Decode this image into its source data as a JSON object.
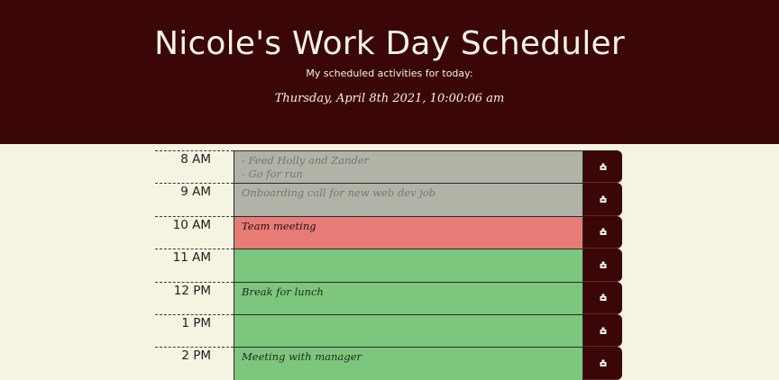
{
  "header": {
    "title": "Nicole's Work Day Scheduler",
    "subtitle": "My scheduled activities for today:",
    "datetime": "Thursday, April 8th 2021, 10:00:06 am"
  },
  "colors": {
    "header_bg": "#3a0608",
    "page_bg": "#f5f3e1",
    "past": "#b1b3a7",
    "present": "#e77b76",
    "future": "#7dc67d"
  },
  "save_icon": "save-icon",
  "hours": [
    {
      "hour": "8 AM",
      "task": "- Feed Holly and Zander\n- Go for run",
      "state": "past"
    },
    {
      "hour": "9 AM",
      "task": "Onboarding call  for new web dev job",
      "state": "past"
    },
    {
      "hour": "10 AM",
      "task": "Team meeting",
      "state": "present"
    },
    {
      "hour": "11 AM",
      "task": "",
      "state": "future"
    },
    {
      "hour": "12 PM",
      "task": "Break for lunch",
      "state": "future"
    },
    {
      "hour": "1 PM",
      "task": "",
      "state": "future"
    },
    {
      "hour": "2 PM",
      "task": "Meeting with manager",
      "state": "future"
    }
  ]
}
